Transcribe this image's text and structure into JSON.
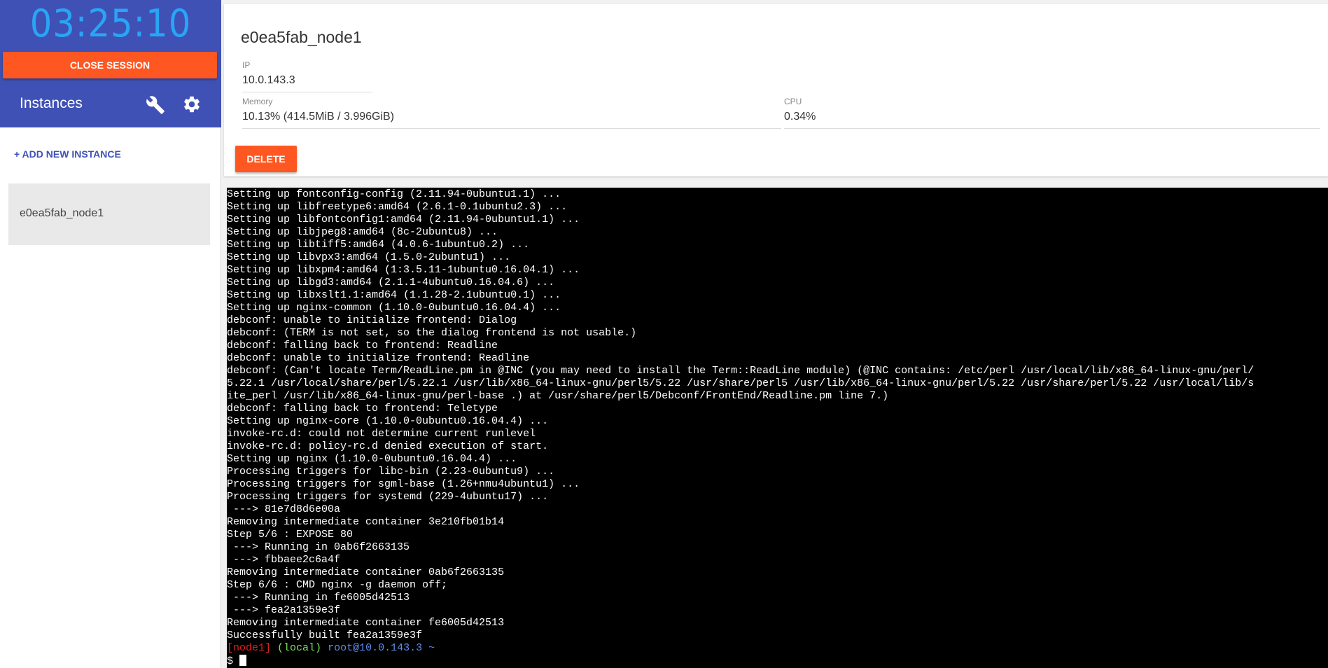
{
  "session": {
    "timer": "03:25:10",
    "close_label": "CLOSE SESSION"
  },
  "sidebar": {
    "title": "Instances",
    "add_label": "+ ADD NEW INSTANCE",
    "instances": [
      {
        "label": "e0ea5fab_node1"
      }
    ]
  },
  "instance": {
    "name": "e0ea5fab_node1",
    "ip_label": "IP",
    "ip_value": "10.0.143.3",
    "memory_label": "Memory",
    "memory_value": "10.13% (414.5MiB / 3.996GiB)",
    "cpu_label": "CPU",
    "cpu_value": "0.34%",
    "delete_label": "DELETE"
  },
  "terminal": {
    "lines": [
      "Setting up fontconfig-config (2.11.94-0ubuntu1.1) ...",
      "Setting up libfreetype6:amd64 (2.6.1-0.1ubuntu2.3) ...",
      "Setting up libfontconfig1:amd64 (2.11.94-0ubuntu1.1) ...",
      "Setting up libjpeg8:amd64 (8c-2ubuntu8) ...",
      "Setting up libtiff5:amd64 (4.0.6-1ubuntu0.2) ...",
      "Setting up libvpx3:amd64 (1.5.0-2ubuntu1) ...",
      "Setting up libxpm4:amd64 (1:3.5.11-1ubuntu0.16.04.1) ...",
      "Setting up libgd3:amd64 (2.1.1-4ubuntu0.16.04.6) ...",
      "Setting up libxslt1.1:amd64 (1.1.28-2.1ubuntu0.1) ...",
      "Setting up nginx-common (1.10.0-0ubuntu0.16.04.4) ...",
      "debconf: unable to initialize frontend: Dialog",
      "debconf: (TERM is not set, so the dialog frontend is not usable.)",
      "debconf: falling back to frontend: Readline",
      "debconf: unable to initialize frontend: Readline",
      "debconf: (Can't locate Term/ReadLine.pm in @INC (you may need to install the Term::ReadLine module) (@INC contains: /etc/perl /usr/local/lib/x86_64-linux-gnu/perl/",
      "5.22.1 /usr/local/share/perl/5.22.1 /usr/lib/x86_64-linux-gnu/perl5/5.22 /usr/share/perl5 /usr/lib/x86_64-linux-gnu/perl/5.22 /usr/share/perl/5.22 /usr/local/lib/s",
      "ite_perl /usr/lib/x86_64-linux-gnu/perl-base .) at /usr/share/perl5/Debconf/FrontEnd/Readline.pm line 7.)",
      "debconf: falling back to frontend: Teletype",
      "Setting up nginx-core (1.10.0-0ubuntu0.16.04.4) ...",
      "invoke-rc.d: could not determine current runlevel",
      "invoke-rc.d: policy-rc.d denied execution of start.",
      "Setting up nginx (1.10.0-0ubuntu0.16.04.4) ...",
      "Processing triggers for libc-bin (2.23-0ubuntu9) ...",
      "Processing triggers for sgml-base (1.26+nmu4ubuntu1) ...",
      "Processing triggers for systemd (229-4ubuntu17) ...",
      " ---> 81e7d8d6e00a",
      "Removing intermediate container 3e210fb01b14",
      "Step 5/6 : EXPOSE 80",
      " ---> Running in 0ab6f2663135",
      " ---> fbbaee2c6a4f",
      "Removing intermediate container 0ab6f2663135",
      "Step 6/6 : CMD nginx -g daemon off;",
      " ---> Running in fe6005d42513",
      " ---> fea2a1359e3f",
      "Removing intermediate container fe6005d42513",
      "Successfully built fea2a1359e3f"
    ],
    "prompt_node": "[node1]",
    "prompt_local": "(local)",
    "prompt_user": "root@10.0.143.3 ~",
    "prompt_symbol": "$ ",
    "colors": {
      "node": "#e02020",
      "local": "#7ce25c",
      "user": "#5f8ff0"
    }
  }
}
